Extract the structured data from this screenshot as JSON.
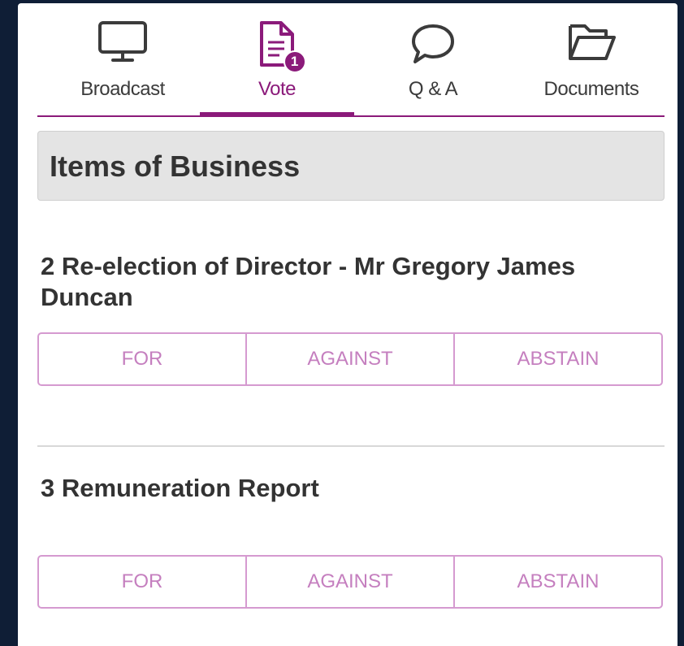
{
  "tabs": [
    {
      "label": "Broadcast",
      "icon": "monitor-icon",
      "active": false
    },
    {
      "label": "Vote",
      "icon": "document-icon",
      "active": true,
      "badge": "1"
    },
    {
      "label": "Q & A",
      "icon": "speech-bubble-icon",
      "active": false
    },
    {
      "label": "Documents",
      "icon": "folder-icon",
      "active": false
    }
  ],
  "section": {
    "title": "Items of Business"
  },
  "items": [
    {
      "title": "2 Re-election of Director - Mr Gregory James Duncan",
      "options": [
        "FOR",
        "AGAINST",
        "ABSTAIN"
      ]
    },
    {
      "title": "3 Remuneration Report",
      "options": [
        "FOR",
        "AGAINST",
        "ABSTAIN"
      ]
    }
  ],
  "colors": {
    "accent": "#8b1a7a",
    "button_border": "#d59ad0",
    "button_text": "#c57fbf"
  }
}
